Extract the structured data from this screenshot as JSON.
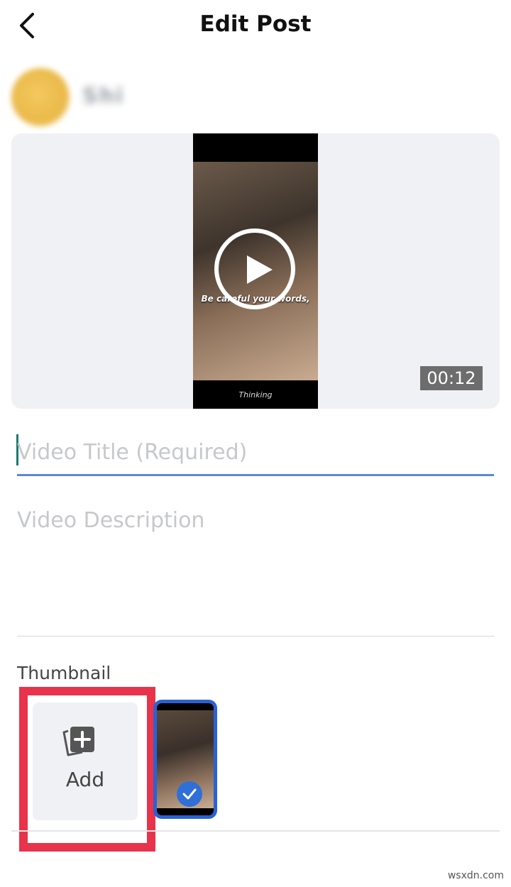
{
  "header": {
    "title": "Edit Post",
    "back_icon": "chevron-left-icon"
  },
  "user": {
    "name": "Shi"
  },
  "video": {
    "caption": "Be careful     your words,",
    "watermark": "Thinking",
    "duration": "00:12",
    "play_icon": "play-icon"
  },
  "form": {
    "title_placeholder": "Video Title (Required)",
    "title_value": "",
    "description_placeholder": "Video Description",
    "description_value": ""
  },
  "thumbnail": {
    "label": "Thumbnail",
    "add_label": "Add",
    "add_icon": "add-image-icon",
    "selected_icon": "check-icon",
    "highlight_color": "#e8334a",
    "selected_color": "#2a62d4"
  },
  "site": "wsxdn.com"
}
